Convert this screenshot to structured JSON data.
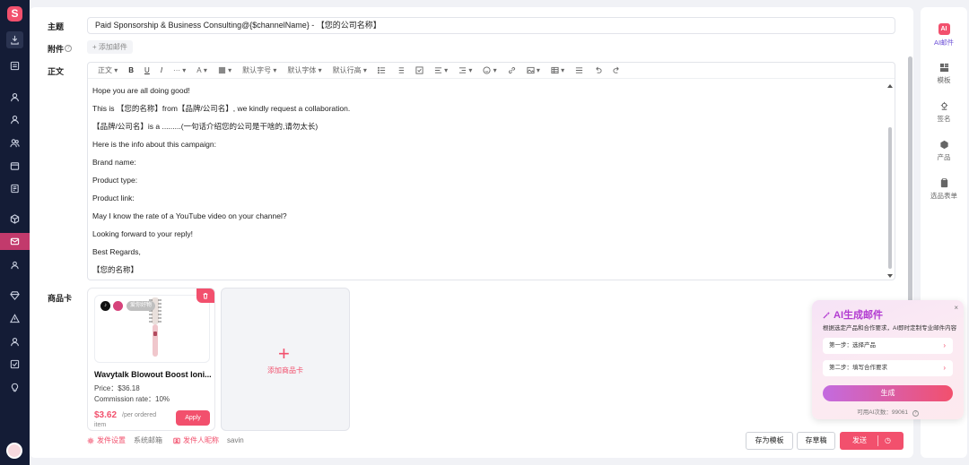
{
  "app": {
    "logo_glyph": "S"
  },
  "sidebar": {
    "icons": [
      "download-icon",
      "list-icon",
      "user-icon",
      "user-icon",
      "users-icon",
      "window-icon",
      "book-icon",
      "box-icon",
      "mail-icon",
      "people-icon",
      "diamond-icon",
      "alert-icon",
      "person-icon",
      "check-icon",
      "bulb-icon"
    ]
  },
  "form": {
    "subject_label": "主题",
    "subject_value": "Paid Sponsorship & Business Consulting@{$channelName} - 【您的公司名称】",
    "attachment_label": "附件",
    "attachment_help": "?",
    "attachment_button": "+ 添加邮件",
    "body_label": "正文",
    "product_label": "商品卡"
  },
  "toolbar": {
    "paragraph": "正文",
    "bold": "B",
    "underline": "U",
    "italic": "I",
    "more": "···",
    "font_color": "A",
    "font_size": "默认字号",
    "font_family": "默认字体",
    "line_height": "默认行高"
  },
  "body_lines": [
    "Hope you are all doing good!",
    "This is 【您的名称】from【品牌/公司名】, we kindly request a collaboration.",
    "【品牌/公司名】is a .........(一句话介绍您的公司是干啥的,请勿太长)",
    "Here is the info about this campaign:",
    "Brand name:",
    "Product type:",
    "Product link:",
    "May I know the rate of a YouTube video on your channel?",
    "Looking forward to your reply!",
    "Best Regards,",
    "【您的名称】"
  ],
  "product": {
    "tag": "爱你好物",
    "tt_glyph": "♪",
    "name": "Wavytalk Blowout Boost Ioni...",
    "price": "Price：$36.18",
    "commission": "Commission rate：10%",
    "amount": "$3.62",
    "per_order": "/per ordered",
    "per_item": "item",
    "apply": "Apply"
  },
  "add_card": {
    "plus": "+",
    "label": "添加商品卡"
  },
  "footer": {
    "send_settings": "发件设置",
    "system_mailbox": "系统邮箱",
    "sender_nickname": "发件人昵称",
    "sender_name": "savin",
    "save_template": "存为模板",
    "save_draft": "存草稿",
    "send": "发送",
    "schedule_glyph": "◷"
  },
  "right_panel": [
    {
      "label": "AI邮件",
      "icon": "ai-icon"
    },
    {
      "label": "模板",
      "icon": "template-icon"
    },
    {
      "label": "签名",
      "icon": "signature-icon"
    },
    {
      "label": "产品",
      "icon": "product-icon"
    },
    {
      "label": "选品表单",
      "icon": "form-icon"
    }
  ],
  "ai_popup": {
    "title": "AI生成邮件",
    "close": "×",
    "description": "根据选定产品和合作要求，AI即时定制专业邮件内容",
    "step1": "第一步：选择产品",
    "step2": "第二步：填写合作要求",
    "arrow": "›",
    "generate": "生成",
    "quota": "可用AI次数：99061",
    "quota_help": "?"
  },
  "colors": {
    "brand": "#f2506d",
    "sidebar_bg": "#141c36",
    "ai_purple": "#b23bd1"
  }
}
